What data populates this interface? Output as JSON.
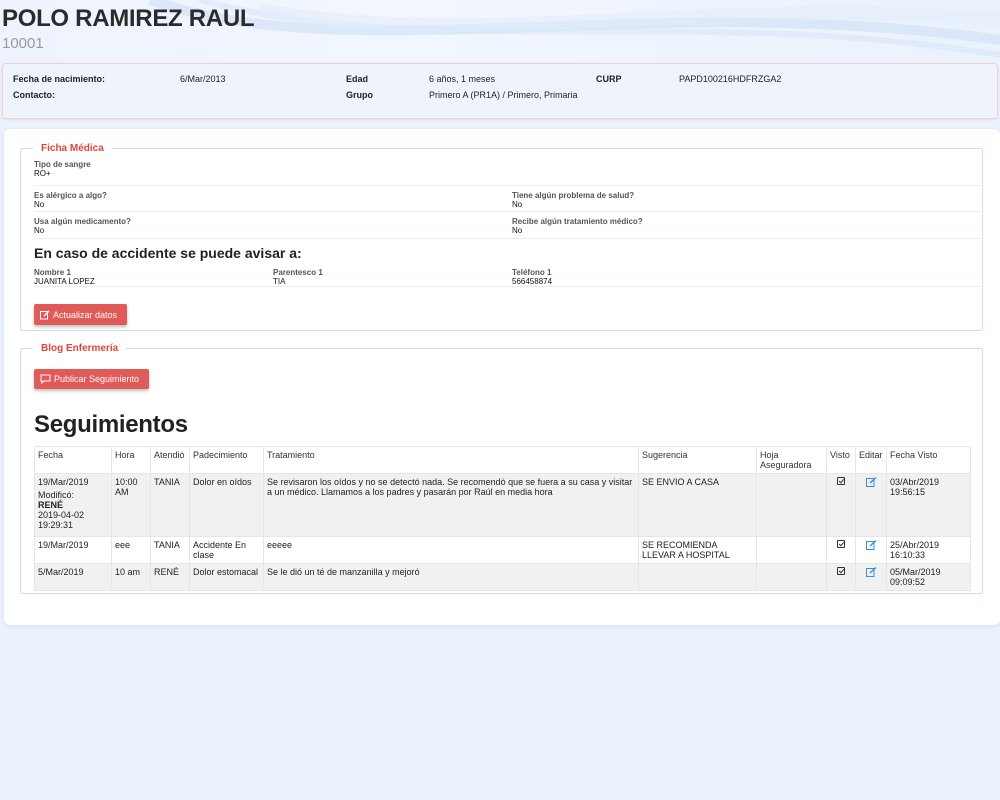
{
  "student": {
    "name": "POLO RAMIREZ RAUL",
    "id": "10001"
  },
  "info": {
    "birth_label": "Fecha de nacimiento:",
    "birth_value": "6/Mar/2013",
    "age_label": "Edad",
    "age_value": "6 años, 1 meses",
    "curp_label": "CURP",
    "curp_value": "PAPD100216HDFRZGA2",
    "contact_label": "Contacto:",
    "group_label": "Grupo",
    "group_value": "Primero A (PR1A) / Primero, Primaria"
  },
  "ficha": {
    "legend": "Ficha Médica",
    "blood_label": "Tipo de sangre",
    "blood_value": "RO+",
    "allergic_label": "Es alérgico a algo?",
    "allergic_value": "No",
    "health_label": "Tiene algún problema de salud?",
    "health_value": "No",
    "medication_label": "Usa algún medicamento?",
    "medication_value": "No",
    "treatment_label": "Recibe algún tratamiento médico?",
    "treatment_value": "No",
    "accident_title": "En caso de accidente se puede avisar a:",
    "name1_label": "Nombre 1",
    "name1_value": "JUANITA LOPEZ",
    "kin1_label": "Parentesco 1",
    "kin1_value": "TIA",
    "phone1_label": "Teléfono 1",
    "phone1_value": "566458874",
    "update_button": "Actualizar datos"
  },
  "blog": {
    "legend": "Blog Enfermería",
    "publish_button": "Publicar Seguimiento",
    "title": "Seguimientos",
    "columns": [
      "Fecha",
      "Hora",
      "Atendió",
      "Padecimiento",
      "Tratamiento",
      "Sugerencia",
      "Hoja Aseguradora",
      "Visto",
      "Editar",
      "Fecha Visto"
    ],
    "rows": [
      {
        "fecha": "19/Mar/2019",
        "mod_label": "Modificó:",
        "mod_by": "RENÉ",
        "mod_date": "2019-04-02",
        "mod_time": "19:29:31",
        "hora": "10:00 AM",
        "atendio": "TANIA",
        "padecimiento": "Dolor en oídos",
        "tratamiento": "Se revisaron los oídos y no se detectó nada. Se recomendó que se fuera a su casa y visitar a un médico. Llamamos a los padres y pasarán por Raúl en media hora",
        "sugerencia": "SE ENVIO A CASA",
        "hoja": "",
        "fecha_visto": "03/Abr/2019",
        "hora_visto": "19:56:15"
      },
      {
        "fecha": "19/Mar/2019",
        "hora": "eee",
        "atendio": "TANIA",
        "padecimiento": "Accidente En clase",
        "tratamiento": "eeeee",
        "sugerencia": "SE RECOMIENDA LLEVAR A HOSPITAL",
        "hoja": "",
        "fecha_visto": "25/Abr/2019",
        "hora_visto": "16:10:33"
      },
      {
        "fecha": "5/Mar/2019",
        "hora": "10 am",
        "atendio": "RENÉ",
        "padecimiento": "Dolor estomacal",
        "tratamiento": "Se le dió un té de manzanilla y mejoró",
        "sugerencia": "",
        "hoja": "",
        "fecha_visto": "05/Mar/2019",
        "hora_visto": "09:09:52"
      }
    ]
  },
  "colors": {
    "accent_red": "#e05a58",
    "legend_red": "#e2423f",
    "page_bg": "#ebf1fd",
    "edit_blue": "#3a8fd6"
  }
}
